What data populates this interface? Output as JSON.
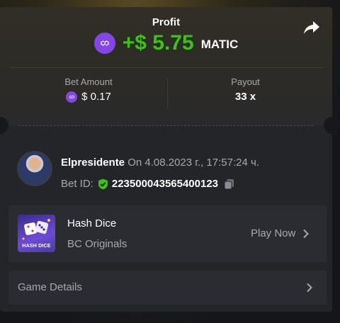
{
  "profit": {
    "title": "Profit",
    "value": "+$ 5.75",
    "currency": "MATIC"
  },
  "bet": {
    "amount_label": "Bet Amount",
    "amount_value": "$ 0.17",
    "payout_label": "Payout",
    "payout_value": "33 x"
  },
  "user": {
    "name": "Elpresidente",
    "datetime": "On 4.08.2023 г., 17:57:24 ч.",
    "bet_id_label": "Bet ID:",
    "bet_id": "223500043565400123"
  },
  "game": {
    "thumb_label": "HASH DICE",
    "name": "Hash Dice",
    "provider": "BC Originals",
    "play_label": "Play Now"
  },
  "details": {
    "label": "Game Details"
  },
  "colors": {
    "profit_green": "#3bc117",
    "matic_purple": "#8247e5",
    "card_bg": "#232529",
    "row_bg": "#2a2c31",
    "muted_text": "#a8a9ab",
    "shield_green": "#3bc117"
  },
  "icons": [
    "matic-coin-icon",
    "share-icon",
    "shield-check-icon",
    "copy-icon",
    "chevron-right-icon"
  ]
}
